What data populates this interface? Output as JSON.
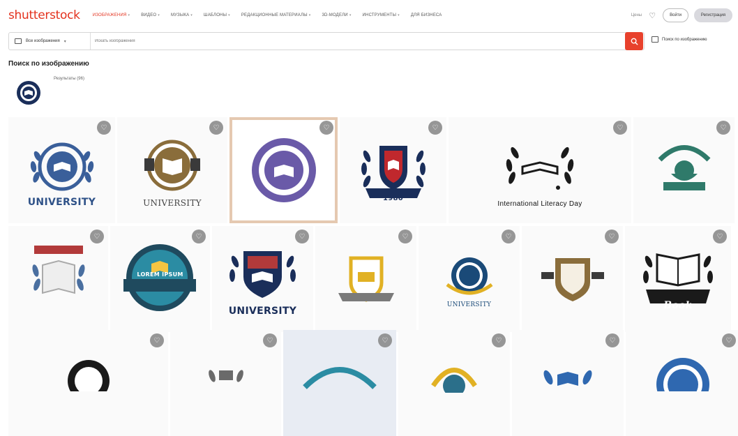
{
  "header": {
    "logo": "shutterstock",
    "nav": [
      {
        "label": "Изображения",
        "active": true,
        "dropdown": true
      },
      {
        "label": "Видео",
        "active": false,
        "dropdown": true
      },
      {
        "label": "Музыка",
        "active": false,
        "dropdown": true
      },
      {
        "label": "Шаблоны",
        "active": false,
        "dropdown": true
      },
      {
        "label": "Редакционные материалы",
        "active": false,
        "dropdown": true
      },
      {
        "label": "3D-модели",
        "active": false,
        "dropdown": true
      },
      {
        "label": "Инструменты",
        "active": false,
        "dropdown": true
      },
      {
        "label": "Для бизнеса",
        "active": false,
        "dropdown": false
      }
    ],
    "lang": "Цены",
    "login_label": "Войти",
    "signup_label": "Регистрация"
  },
  "search": {
    "scope_label": "Все изображения",
    "placeholder": "Искать изображения",
    "image_search_label": "Поиск по изображению"
  },
  "page": {
    "title": "Поиск по изображению",
    "results_label": "Результаты (96)"
  },
  "tiles": {
    "r1_1_caption": "UNIVERSITY",
    "r1_2_caption": "UNIVERSITY",
    "r1_4_caption": "1980",
    "r1_5_caption": "International Literacy Day",
    "r2_3_caption": "UNIVERSITY",
    "r2_6_caption": "UNIVERSITY",
    "r2_7_caption": "Book",
    "r2_2_text": "LOREM IPSUM"
  },
  "colors": {
    "brand": "#e3311d",
    "search_button": "#e8412c",
    "navy": "#1a2e5a"
  }
}
